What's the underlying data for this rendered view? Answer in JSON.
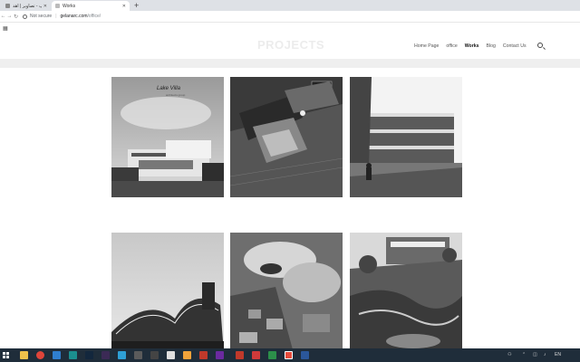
{
  "browser": {
    "tabs": [
      {
        "title": "ایماژ تاپ - تصاویر | اهد"
      },
      {
        "title": "Works"
      }
    ],
    "new_tab": "+",
    "address": {
      "security": "Not secure",
      "host": "gelanarc.com",
      "path": "/office/"
    }
  },
  "site": {
    "heading": "PROJECTS",
    "menu": [
      {
        "label": "Home Page"
      },
      {
        "label": "office"
      },
      {
        "label": "Works"
      },
      {
        "label": "Blog"
      },
      {
        "label": "Contact Us"
      }
    ]
  },
  "gallery": [
    {
      "caption": "Lake Villa",
      "subtitle": "architects group"
    },
    {
      "caption": ""
    },
    {
      "caption": ""
    },
    {
      "caption": ""
    },
    {
      "caption": ""
    },
    {
      "caption": ""
    }
  ],
  "taskbar": {
    "tray_text": "EN"
  }
}
